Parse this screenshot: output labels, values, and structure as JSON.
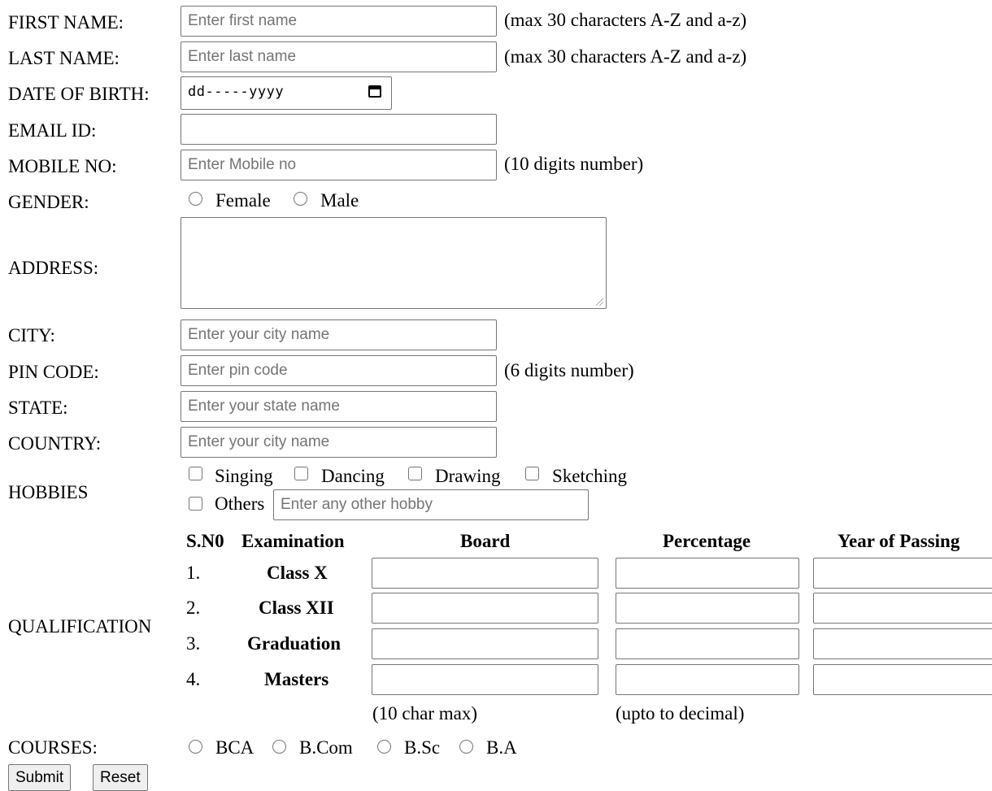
{
  "form": {
    "first_name": {
      "label": "FIRST NAME:",
      "placeholder": "Enter first name",
      "note": "(max 30 characters A-Z and a-z)"
    },
    "last_name": {
      "label": "LAST NAME:",
      "placeholder": "Enter last name",
      "note": "(max 30 characters A-Z and a-z)"
    },
    "dob": {
      "label": "DATE OF BIRTH:",
      "value": "dd-----yyyy",
      "icon": "calendar-icon"
    },
    "email": {
      "label": "EMAIL ID:"
    },
    "mobile": {
      "label": "MOBILE NO:",
      "placeholder": "Enter Mobile no",
      "note": "(10 digits number)"
    },
    "gender": {
      "label": "GENDER:",
      "options": [
        "Female",
        "Male"
      ]
    },
    "address": {
      "label": "ADDRESS:"
    },
    "city": {
      "label": "CITY:",
      "placeholder": "Enter your city name"
    },
    "pin": {
      "label": "PIN CODE:",
      "placeholder": "Enter pin code",
      "note": "(6 digits number)"
    },
    "state": {
      "label": "STATE:",
      "placeholder": "Enter your state name"
    },
    "country": {
      "label": "COUNTRY:",
      "placeholder": "Enter your city name"
    },
    "hobbies": {
      "label": "HOBBIES",
      "options": [
        "Singing",
        "Dancing",
        "Drawing",
        "Sketching",
        "Others"
      ],
      "other_placeholder": "Enter any other hobby"
    },
    "qualification": {
      "label": "QUALIFICATION",
      "headers": [
        "S.N0",
        "Examination",
        "Board",
        "Percentage",
        "Year of Passing"
      ],
      "rows": [
        {
          "sn": "1.",
          "exam": "Class X"
        },
        {
          "sn": "2.",
          "exam": "Class XII"
        },
        {
          "sn": "3.",
          "exam": "Graduation"
        },
        {
          "sn": "4.",
          "exam": "Masters"
        }
      ],
      "board_note": "(10 char max)",
      "percentage_note": "(upto to decimal)"
    },
    "courses": {
      "label": "COURSES:",
      "options": [
        "BCA",
        "B.Com",
        "B.Sc",
        "B.A"
      ]
    },
    "buttons": {
      "submit": "Submit",
      "reset": "Reset"
    }
  }
}
